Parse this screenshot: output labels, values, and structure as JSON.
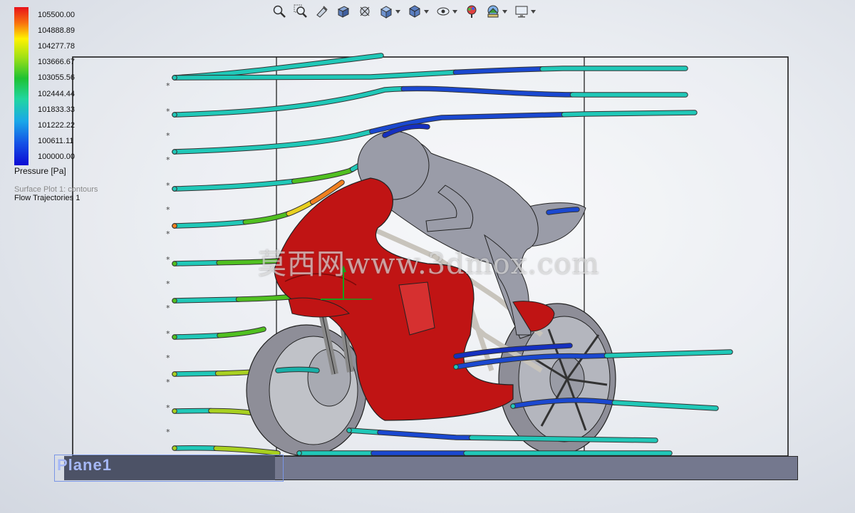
{
  "toolbar": {
    "icons": [
      "zoom-to-fit-icon",
      "zoom-to-area-icon",
      "previous-view-icon",
      "section-view-icon",
      "dynamic-annotation-icon",
      "view-orientation-icon",
      "display-style-icon",
      "hide-show-items-icon",
      "edit-appearance-icon",
      "apply-scene-icon",
      "view-settings-icon"
    ]
  },
  "legend": {
    "values": [
      "105500.00",
      "104888.89",
      "104277.78",
      "103666.67",
      "103055.56",
      "102444.44",
      "101833.33",
      "101222.22",
      "100611.11",
      "100000.00"
    ],
    "title": "Pressure [Pa]",
    "colors": [
      "#e8121a",
      "#f8700e",
      "#fff200",
      "#9ee017",
      "#1fc233",
      "#21d6a0",
      "#1aa8e8",
      "#1552e6",
      "#0c0bd4"
    ]
  },
  "plots": {
    "surface_plot": "Surface Plot 1: contours",
    "trajectories": "Flow Trajectories 1"
  },
  "plane": {
    "label": "Plane1"
  },
  "watermark": "莫西网www.3dmox.com",
  "colors": {
    "fairing": "#c01414",
    "body": "#9a9ca8",
    "frame": "#c8c4bc",
    "tire": "#8e8e98",
    "trajectory_low": "#1533d0",
    "trajectory_high": "#f0d020"
  }
}
